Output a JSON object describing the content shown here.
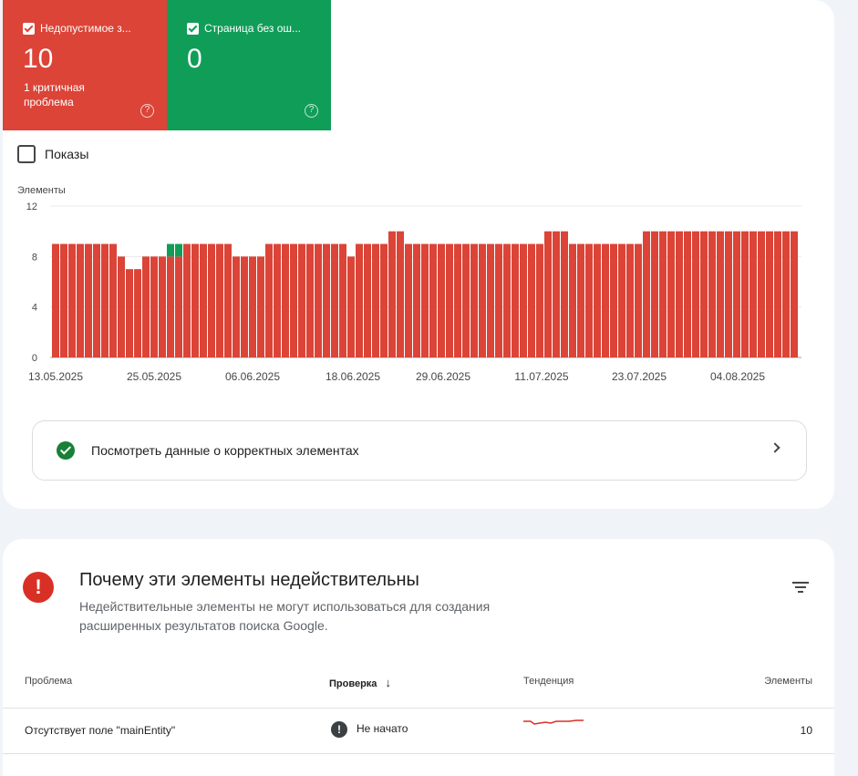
{
  "tiles": {
    "invalid": {
      "label": "Недопустимое з...",
      "count": "10",
      "sub": "1 критичная проблема",
      "help": "?"
    },
    "valid": {
      "label": "Страница без ош...",
      "count": "0",
      "help": "?"
    }
  },
  "shows_label": "Показы",
  "chart_data": {
    "type": "bar",
    "ylabel": "Элементы",
    "ylim": [
      0,
      12
    ],
    "yticks": [
      0,
      4,
      8,
      12
    ],
    "xtick_labels": [
      "13.05.2025",
      "25.05.2025",
      "06.06.2025",
      "18.06.2025",
      "29.06.2025",
      "11.07.2025",
      "23.07.2025",
      "04.08.2025"
    ],
    "series": [
      {
        "color": "#db4437",
        "values": [
          9,
          9,
          9,
          9,
          9,
          9,
          9,
          9,
          8,
          7,
          7,
          8,
          8,
          8,
          8,
          8,
          9,
          9,
          9,
          9,
          9,
          9,
          8,
          8,
          8,
          8,
          9,
          9,
          9,
          9,
          9,
          9,
          9,
          9,
          9,
          9,
          8,
          9,
          9,
          9,
          9,
          10,
          10,
          9,
          9,
          9,
          9,
          9,
          9,
          9,
          9,
          9,
          9,
          9,
          9,
          9,
          9,
          9,
          9,
          9,
          10,
          10,
          10,
          9,
          9,
          9,
          9,
          9,
          9,
          9,
          9,
          9,
          10,
          10,
          10,
          10,
          10,
          10,
          10,
          10,
          10,
          10,
          10,
          10,
          10,
          10,
          10,
          10,
          10,
          10,
          10
        ]
      },
      {
        "color": "#109d58",
        "values": [
          0,
          0,
          0,
          0,
          0,
          0,
          0,
          0,
          0,
          0,
          0,
          0,
          0,
          0,
          1,
          1,
          0,
          0,
          0,
          0,
          0,
          0,
          0,
          0,
          0,
          0,
          0,
          0,
          0,
          0,
          0,
          0,
          0,
          0,
          0,
          0,
          0,
          0,
          0,
          0,
          0,
          0,
          0,
          0,
          0,
          0,
          0,
          0,
          0,
          0,
          0,
          0,
          0,
          0,
          0,
          0,
          0,
          0,
          0,
          0,
          0,
          0,
          0,
          0,
          0,
          0,
          0,
          0,
          0,
          0,
          0,
          0,
          0,
          0,
          0,
          0,
          0,
          0,
          0,
          0,
          0,
          0,
          0,
          0,
          0,
          0,
          0,
          0,
          0,
          0,
          0
        ]
      }
    ]
  },
  "valid_link": "Посмотреть данные о корректных элементах",
  "section": {
    "title": "Почему эти элементы недействительны",
    "desc": "Недействительные элементы не могут использоваться для создания расширенных результатов поиска Google.",
    "icon": "!"
  },
  "table": {
    "headers": {
      "problem": "Проблема",
      "check": "Проверка",
      "check_arrow": "↓",
      "trend": "Тенденция",
      "items": "Элементы"
    },
    "rows": [
      {
        "problem": "Отсутствует поле \"mainEntity\"",
        "status_icon": "!",
        "status": "Не начато",
        "items": "10",
        "trend_color": "#d93025"
      }
    ]
  }
}
